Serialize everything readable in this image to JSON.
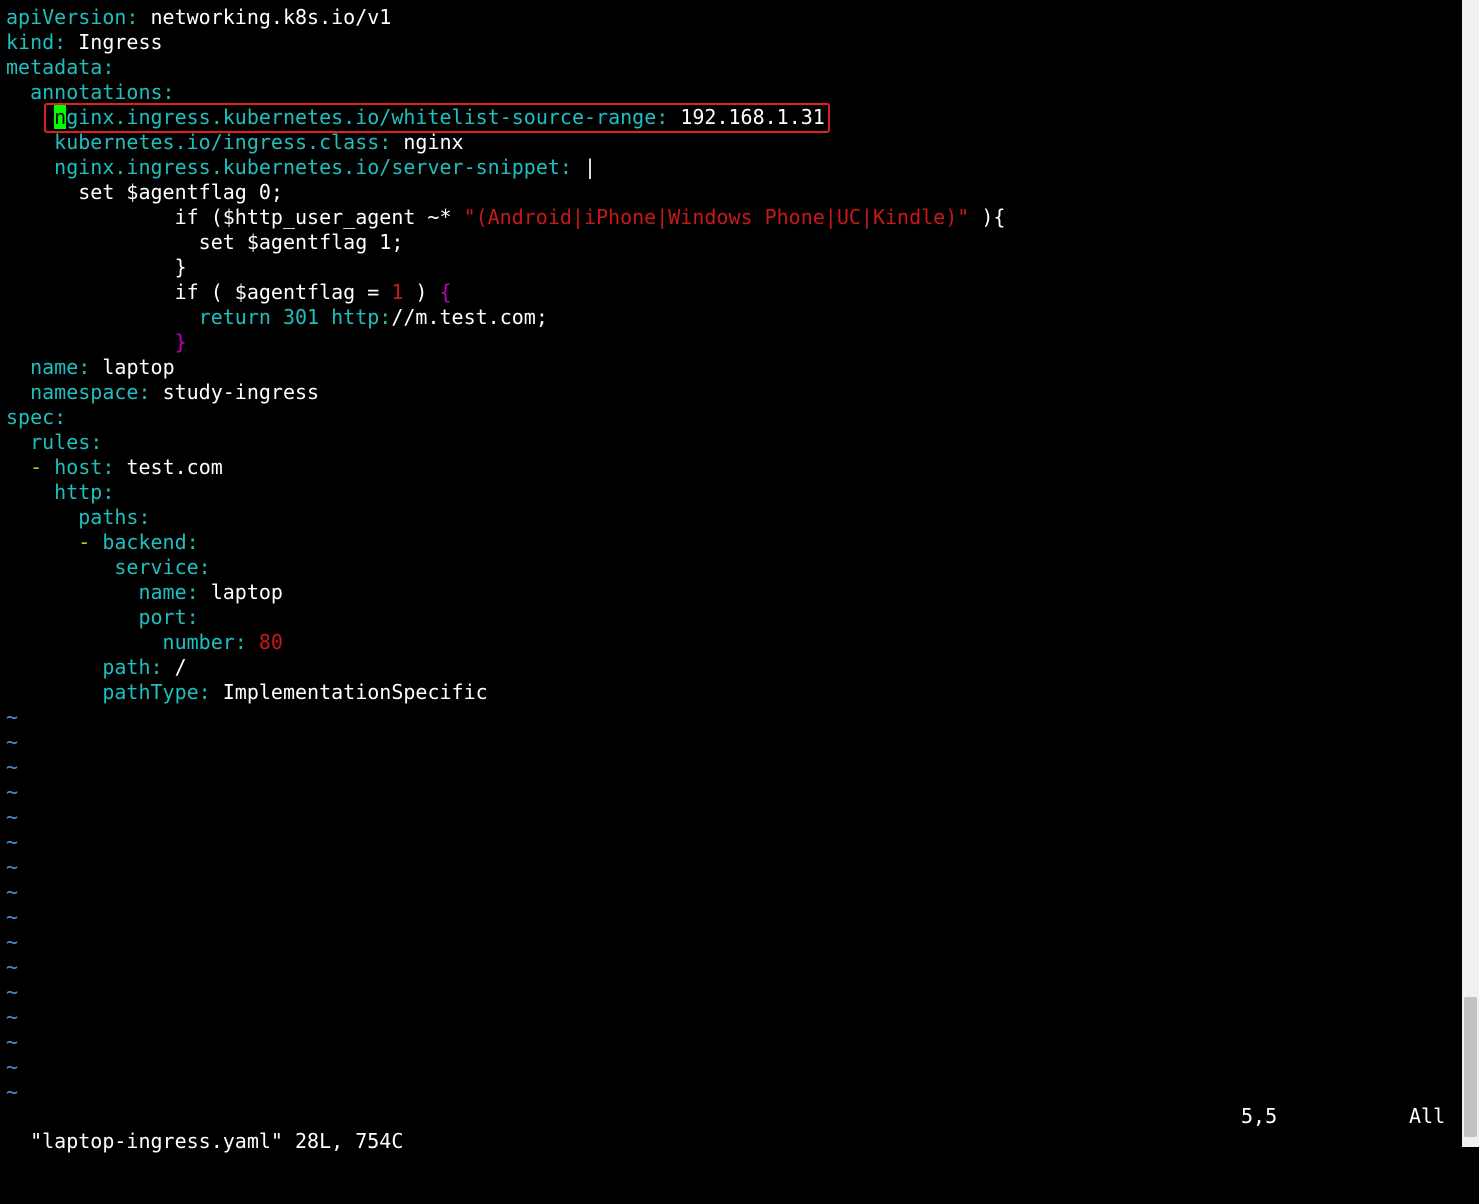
{
  "colors": {
    "key": "#1fbfbf",
    "text": "#ffffff",
    "string": "#c81818",
    "number": "#c81818",
    "brace": "#c000c0",
    "punct": "#1fbfbf",
    "dash": "#c8c800",
    "tilde": "#4a8fd6",
    "cursor": "#00ff00",
    "box": "#e0201c"
  },
  "lines": [
    [
      {
        "t": "apiVersion",
        "c": "key"
      },
      {
        "t": ": ",
        "c": "punct"
      },
      {
        "t": "networking.k8s.io/v1",
        "c": "text"
      }
    ],
    [
      {
        "t": "kind",
        "c": "key"
      },
      {
        "t": ": ",
        "c": "punct"
      },
      {
        "t": "Ingress",
        "c": "text"
      }
    ],
    [
      {
        "t": "metadata",
        "c": "key"
      },
      {
        "t": ":",
        "c": "punct"
      }
    ],
    [
      {
        "t": "  "
      },
      {
        "t": "annotations",
        "c": "key"
      },
      {
        "t": ":",
        "c": "punct"
      }
    ],
    [
      {
        "t": "    "
      },
      {
        "t": "n",
        "c": "cursor"
      },
      {
        "t": "ginx.ingress.kubernetes.io/whitelist-source-range",
        "c": "key"
      },
      {
        "t": ": ",
        "c": "punct"
      },
      {
        "t": "192.168.1.31",
        "c": "text"
      }
    ],
    [
      {
        "t": "    "
      },
      {
        "t": "kubernetes.io/ingress.class",
        "c": "key"
      },
      {
        "t": ": ",
        "c": "punct"
      },
      {
        "t": "nginx",
        "c": "text"
      }
    ],
    [
      {
        "t": "    "
      },
      {
        "t": "nginx.ingress.kubernetes.io/server-snippet",
        "c": "key"
      },
      {
        "t": ": ",
        "c": "punct"
      },
      {
        "t": "|",
        "c": "text"
      }
    ],
    [
      {
        "t": "      set $agentflag 0;",
        "c": "text"
      }
    ],
    [
      {
        "t": "              if ($http_user_agent ~* ",
        "c": "text"
      },
      {
        "t": "\"(Android|iPhone|Windows Phone|UC|Kindle)\"",
        "c": "string"
      },
      {
        "t": " ){",
        "c": "text"
      }
    ],
    [
      {
        "t": "                set $agentflag 1;",
        "c": "text"
      }
    ],
    [
      {
        "t": "              }",
        "c": "text"
      }
    ],
    [
      {
        "t": "              if ( $agentflag = ",
        "c": "text"
      },
      {
        "t": "1",
        "c": "number"
      },
      {
        "t": " ) ",
        "c": "text"
      },
      {
        "t": "{",
        "c": "brace"
      }
    ],
    [
      {
        "t": "                "
      },
      {
        "t": "return 301 http",
        "c": "key"
      },
      {
        "t": ":",
        "c": "punct"
      },
      {
        "t": "//m.test.com;",
        "c": "text"
      }
    ],
    [
      {
        "t": "              "
      },
      {
        "t": "}",
        "c": "brace"
      }
    ],
    [
      {
        "t": "  "
      },
      {
        "t": "name",
        "c": "key"
      },
      {
        "t": ": ",
        "c": "punct"
      },
      {
        "t": "laptop",
        "c": "text"
      }
    ],
    [
      {
        "t": "  "
      },
      {
        "t": "namespace",
        "c": "key"
      },
      {
        "t": ": ",
        "c": "punct"
      },
      {
        "t": "study-ingress",
        "c": "text"
      }
    ],
    [
      {
        "t": "spec",
        "c": "key"
      },
      {
        "t": ":",
        "c": "punct"
      }
    ],
    [
      {
        "t": "  "
      },
      {
        "t": "rules",
        "c": "key"
      },
      {
        "t": ":",
        "c": "punct"
      }
    ],
    [
      {
        "t": "  "
      },
      {
        "t": "- ",
        "c": "dash"
      },
      {
        "t": "host",
        "c": "key"
      },
      {
        "t": ": ",
        "c": "punct"
      },
      {
        "t": "test.com",
        "c": "text"
      }
    ],
    [
      {
        "t": "    "
      },
      {
        "t": "http",
        "c": "key"
      },
      {
        "t": ":",
        "c": "punct"
      }
    ],
    [
      {
        "t": "      "
      },
      {
        "t": "paths",
        "c": "key"
      },
      {
        "t": ":",
        "c": "punct"
      }
    ],
    [
      {
        "t": "      "
      },
      {
        "t": "- ",
        "c": "dash"
      },
      {
        "t": "backend",
        "c": "key"
      },
      {
        "t": ":",
        "c": "punct"
      }
    ],
    [
      {
        "t": "         "
      },
      {
        "t": "service",
        "c": "key"
      },
      {
        "t": ":",
        "c": "punct"
      }
    ],
    [
      {
        "t": "           "
      },
      {
        "t": "name",
        "c": "key"
      },
      {
        "t": ": ",
        "c": "punct"
      },
      {
        "t": "laptop",
        "c": "text"
      }
    ],
    [
      {
        "t": "           "
      },
      {
        "t": "port",
        "c": "key"
      },
      {
        "t": ":",
        "c": "punct"
      }
    ],
    [
      {
        "t": "             "
      },
      {
        "t": "number",
        "c": "key"
      },
      {
        "t": ": ",
        "c": "punct"
      },
      {
        "t": "80",
        "c": "number"
      }
    ],
    [
      {
        "t": "        "
      },
      {
        "t": "path",
        "c": "key"
      },
      {
        "t": ": ",
        "c": "punct"
      },
      {
        "t": "/",
        "c": "text"
      }
    ],
    [
      {
        "t": "        "
      },
      {
        "t": "pathType",
        "c": "key"
      },
      {
        "t": ": ",
        "c": "punct"
      },
      {
        "t": "ImplementationSpecific",
        "c": "text"
      }
    ]
  ],
  "empty_line_marker": "~",
  "empty_line_count": 16,
  "status": {
    "file": "\"laptop-ingress.yaml\" 28L, 754C",
    "position": "5,5",
    "scroll": "All"
  }
}
